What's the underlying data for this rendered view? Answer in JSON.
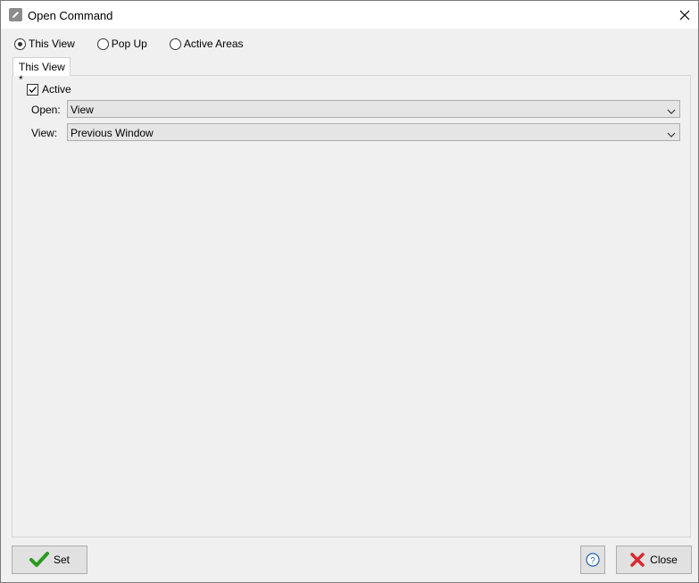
{
  "window": {
    "title": "Open Command",
    "close_icon": "close-icon"
  },
  "modes": [
    {
      "label": "This View",
      "checked": true
    },
    {
      "label": "Pop Up",
      "checked": false
    },
    {
      "label": "Active Areas",
      "checked": false
    }
  ],
  "tab": {
    "label": "This View *"
  },
  "active": {
    "label": "Active",
    "checked": true
  },
  "open_field": {
    "label": "Open:",
    "value": "View"
  },
  "view_field": {
    "label": "View:",
    "value": "Previous Window"
  },
  "buttons": {
    "set": "Set",
    "help_icon": "help-icon",
    "close": "Close"
  },
  "colors": {
    "set_check": "#2a9a1e",
    "close_x": "#d9282f",
    "help": "#1f5fb5"
  }
}
